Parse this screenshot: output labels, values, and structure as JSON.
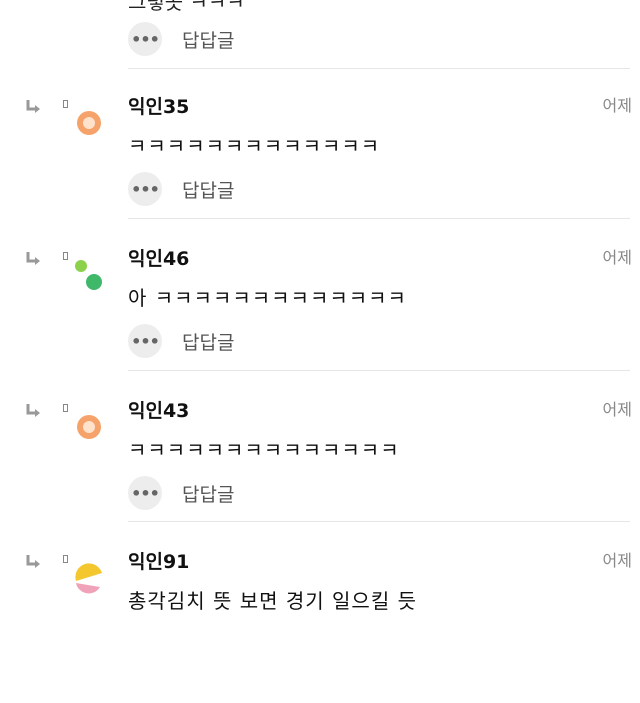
{
  "top_partial": {
    "text": "그렇곳 ㅋㅋㅋ",
    "reply_label": "답답글"
  },
  "comments": [
    {
      "name": "익인35",
      "time": "어제",
      "text": "ㅋㅋㅋㅋㅋㅋㅋㅋㅋㅋㅋㅋㅋ",
      "reply_label": "답답글"
    },
    {
      "name": "익인46",
      "time": "어제",
      "text": "아 ㅋㅋㅋㅋㅋㅋㅋㅋㅋㅋㅋㅋㅋ",
      "reply_label": "답답글"
    },
    {
      "name": "익인43",
      "time": "어제",
      "text": "ㅋㅋㅋㅋㅋㅋㅋㅋㅋㅋㅋㅋㅋㅋ",
      "reply_label": "답답글"
    },
    {
      "name": "익인91",
      "time": "어제",
      "text": "총각김치 뜻 보면 경기 일으킬 듯"
    }
  ],
  "colors": {
    "avatar_orange": "#f5a36b",
    "avatar_green_light": "#8bd14c",
    "avatar_green": "#3fb86a",
    "avatar_yellow": "#f4c72e",
    "avatar_pink": "#f0a3b8"
  }
}
